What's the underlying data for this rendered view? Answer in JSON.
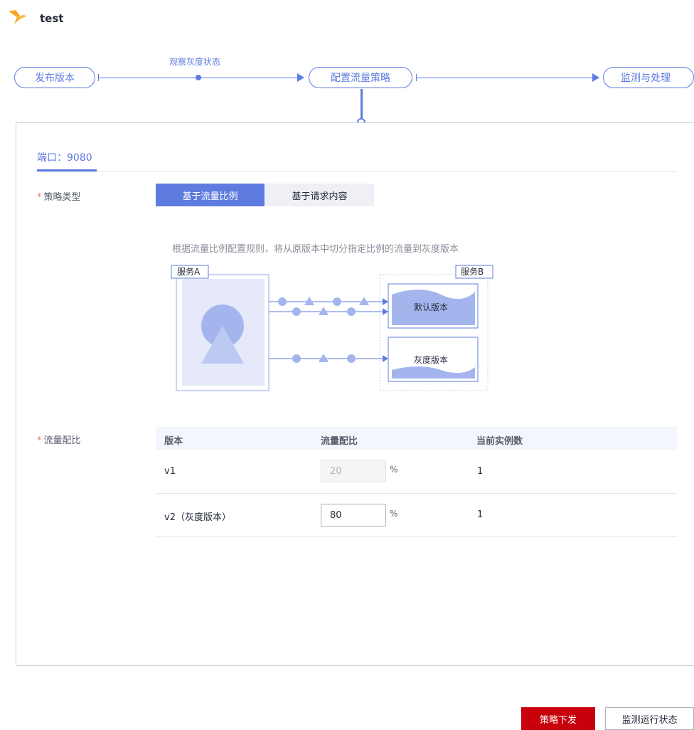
{
  "app": {
    "title": "test"
  },
  "flow": {
    "steps": [
      "发布版本",
      "配置流量策略",
      "监测与处理"
    ],
    "note": "观察灰度状态"
  },
  "panel": {
    "port_tab": "端口：9080",
    "strategy": {
      "label": "策略类型",
      "options": [
        "基于流量比例",
        "基于请求内容"
      ],
      "selected": "基于流量比例"
    },
    "description": "根据流量比例配置规则，将从原版本中切分指定比例的流量到灰度版本",
    "diagram": {
      "service_a": "服务A",
      "service_b": "服务B",
      "default_version": "默认版本",
      "gray_version": "灰度版本"
    },
    "traffic": {
      "label": "流量配比",
      "columns": [
        "版本",
        "流量配比",
        "当前实例数"
      ],
      "rows": [
        {
          "version": "v1",
          "ratio": "20",
          "unit": "%",
          "instances": "1",
          "disabled": true
        },
        {
          "version": "v2（灰度版本）",
          "ratio": "80",
          "unit": "%",
          "instances": "1",
          "disabled": false
        }
      ]
    }
  },
  "actions": {
    "submit": "策略下发",
    "monitor": "监测运行状态"
  },
  "colors": {
    "accent": "#5e7ce0",
    "danger": "#c7000b",
    "required": "#f66f6a",
    "logo": "#f6a623"
  }
}
